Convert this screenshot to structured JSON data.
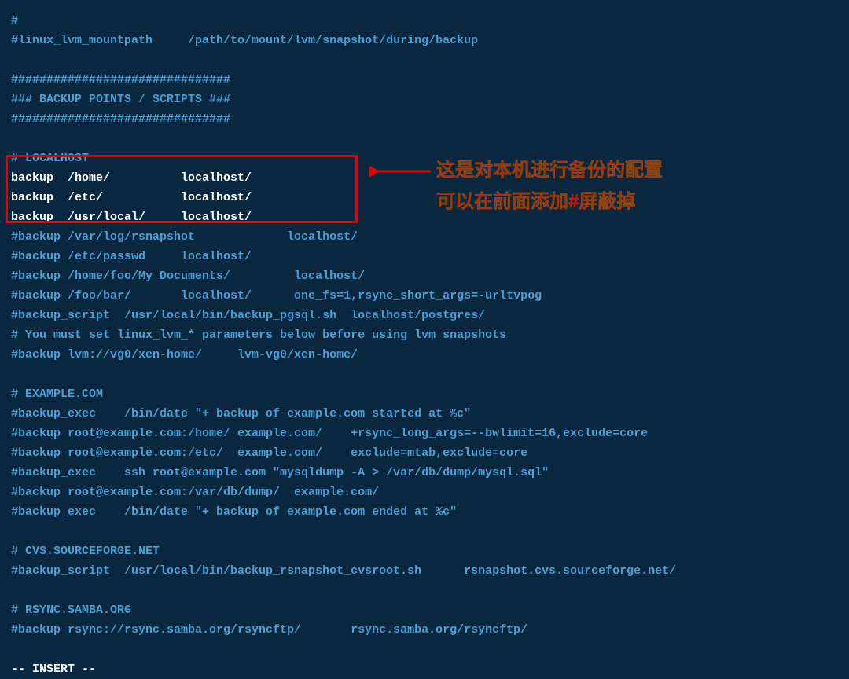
{
  "lines": [
    {
      "cls": "line-comment",
      "text": "#"
    },
    {
      "cls": "line-comment",
      "text": "#linux_lvm_mountpath     /path/to/mount/lvm/snapshot/during/backup"
    },
    {
      "cls": "line-comment",
      "text": ""
    },
    {
      "cls": "line-comment",
      "text": "###############################"
    },
    {
      "cls": "line-comment",
      "text": "### BACKUP POINTS / SCRIPTS ###"
    },
    {
      "cls": "line-comment",
      "text": "###############################"
    },
    {
      "cls": "line-comment",
      "text": ""
    },
    {
      "cls": "line-comment",
      "text": "# LOCALHOST"
    },
    {
      "cls": "line-plain",
      "text": "backup  /home/          localhost/"
    },
    {
      "cls": "line-plain",
      "text": "backup  /etc/           localhost/"
    },
    {
      "cls": "line-plain",
      "text": "backup  /usr/local/     localhost/"
    },
    {
      "cls": "line-comment",
      "text": "#backup /var/log/rsnapshot             localhost/"
    },
    {
      "cls": "line-comment",
      "text": "#backup /etc/passwd     localhost/"
    },
    {
      "cls": "line-comment",
      "text": "#backup /home/foo/My Documents/         localhost/"
    },
    {
      "cls": "line-comment",
      "text": "#backup /foo/bar/       localhost/      one_fs=1,rsync_short_args=-urltvpog"
    },
    {
      "cls": "line-comment",
      "text": "#backup_script  /usr/local/bin/backup_pgsql.sh  localhost/postgres/"
    },
    {
      "cls": "line-comment",
      "text": "# You must set linux_lvm_* parameters below before using lvm snapshots"
    },
    {
      "cls": "line-comment",
      "text": "#backup lvm://vg0/xen-home/     lvm-vg0/xen-home/"
    },
    {
      "cls": "line-comment",
      "text": ""
    },
    {
      "cls": "line-comment",
      "text": "# EXAMPLE.COM"
    },
    {
      "cls": "line-comment",
      "text": "#backup_exec    /bin/date \"+ backup of example.com started at %c\""
    },
    {
      "cls": "line-comment",
      "text": "#backup root@example.com:/home/ example.com/    +rsync_long_args=--bwlimit=16,exclude=core"
    },
    {
      "cls": "line-comment",
      "text": "#backup root@example.com:/etc/  example.com/    exclude=mtab,exclude=core"
    },
    {
      "cls": "line-comment",
      "text": "#backup_exec    ssh root@example.com \"mysqldump -A > /var/db/dump/mysql.sql\""
    },
    {
      "cls": "line-comment",
      "text": "#backup root@example.com:/var/db/dump/  example.com/"
    },
    {
      "cls": "line-comment",
      "text": "#backup_exec    /bin/date \"+ backup of example.com ended at %c\""
    },
    {
      "cls": "line-comment",
      "text": ""
    },
    {
      "cls": "line-comment",
      "text": "# CVS.SOURCEFORGE.NET"
    },
    {
      "cls": "line-comment",
      "text": "#backup_script  /usr/local/bin/backup_rsnapshot_cvsroot.sh      rsnapshot.cvs.sourceforge.net/"
    },
    {
      "cls": "line-comment",
      "text": ""
    },
    {
      "cls": "line-comment",
      "text": "# RSYNC.SAMBA.ORG"
    },
    {
      "cls": "line-comment",
      "text": "#backup rsync://rsync.samba.org/rsyncftp/       rsync.samba.org/rsyncftp/"
    },
    {
      "cls": "line-comment",
      "text": ""
    },
    {
      "cls": "status-line",
      "text": "-- INSERT --"
    }
  ],
  "annotation": {
    "line1": "这是对本机进行备份的配置",
    "line2": "可以在前面添加#屏蔽掉"
  }
}
